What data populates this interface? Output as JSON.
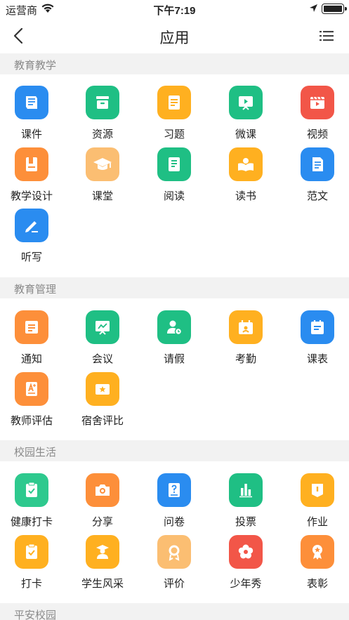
{
  "status_bar": {
    "carrier": "运营商",
    "time": "下午7:19"
  },
  "nav": {
    "title": "应用"
  },
  "sections": [
    {
      "title": "教育教学",
      "items": [
        {
          "label": "课件",
          "icon": "book-icon",
          "color": "#2a8cf0"
        },
        {
          "label": "资源",
          "icon": "archive-box-icon",
          "color": "#1fbf84"
        },
        {
          "label": "习题",
          "icon": "document-icon",
          "color": "#ffb020"
        },
        {
          "label": "微课",
          "icon": "presentation-play-icon",
          "color": "#1fbf84"
        },
        {
          "label": "视频",
          "icon": "video-icon",
          "color": "#f25648"
        },
        {
          "label": "教学设计",
          "icon": "binder-icon",
          "color": "#fd8f3a"
        },
        {
          "label": "课堂",
          "icon": "graduation-cap-icon",
          "color": "#fbbe72"
        },
        {
          "label": "阅读",
          "icon": "open-book-icon",
          "color": "#1fbf84"
        },
        {
          "label": "读书",
          "icon": "reader-icon",
          "color": "#ffb020"
        },
        {
          "label": "范文",
          "icon": "article-icon",
          "color": "#2a8cf0"
        },
        {
          "label": "听写",
          "icon": "pencil-icon",
          "color": "#2a8cf0"
        }
      ]
    },
    {
      "title": "教育管理",
      "items": [
        {
          "label": "通知",
          "icon": "notice-icon",
          "color": "#fd8f3a"
        },
        {
          "label": "会议",
          "icon": "meeting-board-icon",
          "color": "#1fbf84"
        },
        {
          "label": "请假",
          "icon": "person-clock-icon",
          "color": "#1fbf84"
        },
        {
          "label": "考勤",
          "icon": "attendance-calendar-icon",
          "color": "#ffb020"
        },
        {
          "label": "课表",
          "icon": "schedule-icon",
          "color": "#2a8cf0"
        },
        {
          "label": "教师评估",
          "icon": "grade-a-icon",
          "color": "#fd8f3a"
        },
        {
          "label": "宿舍评比",
          "icon": "star-card-icon",
          "color": "#ffb020"
        }
      ]
    },
    {
      "title": "校园生活",
      "items": [
        {
          "label": "健康打卡",
          "icon": "health-check-icon",
          "color": "#2ec98e"
        },
        {
          "label": "分享",
          "icon": "camera-icon",
          "color": "#fd8f3a"
        },
        {
          "label": "问卷",
          "icon": "questionnaire-icon",
          "color": "#2a8cf0"
        },
        {
          "label": "投票",
          "icon": "bar-chart-icon",
          "color": "#1fbf84"
        },
        {
          "label": "作业",
          "icon": "homework-icon",
          "color": "#ffb020"
        },
        {
          "label": "打卡",
          "icon": "clipboard-check-icon",
          "color": "#ffb020"
        },
        {
          "label": "学生风采",
          "icon": "student-icon",
          "color": "#ffb020"
        },
        {
          "label": "评价",
          "icon": "medal-icon",
          "color": "#fbbe72"
        },
        {
          "label": "少年秀",
          "icon": "flower-icon",
          "color": "#f25648"
        },
        {
          "label": "表彰",
          "icon": "award-ribbon-icon",
          "color": "#fd8f3a"
        }
      ]
    },
    {
      "title": "平安校园",
      "items": []
    }
  ]
}
